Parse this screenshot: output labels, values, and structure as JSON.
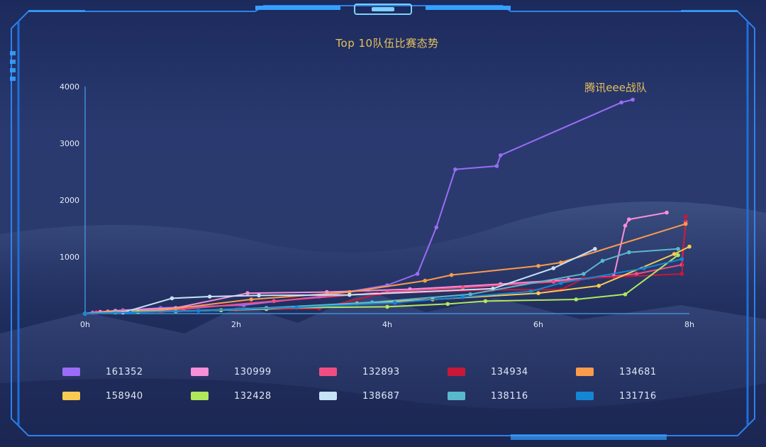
{
  "chart_data": {
    "type": "line",
    "title": "Top 10队伍比赛态势",
    "annotation": "腾讯eee战队",
    "xlim": [
      0,
      8
    ],
    "ylim": [
      0,
      4000
    ],
    "x_ticks": [
      {
        "v": 0,
        "label": "0h"
      },
      {
        "v": 2,
        "label": "2h"
      },
      {
        "v": 4,
        "label": "4h"
      },
      {
        "v": 6,
        "label": "6h"
      },
      {
        "v": 8,
        "label": "8h"
      }
    ],
    "y_ticks": [
      {
        "v": 1000,
        "label": "1000"
      },
      {
        "v": 2000,
        "label": "2000"
      },
      {
        "v": 3000,
        "label": "3000"
      },
      {
        "v": 4000,
        "label": "4000"
      }
    ],
    "grid": false,
    "legend_position": "bottom",
    "series": [
      {
        "name": "161352",
        "color": "#9a6cf7",
        "x": [
          0,
          0.1,
          0.3,
          0.5,
          1.0,
          2.1,
          3.1,
          4.0,
          4.4,
          4.65,
          4.9,
          5.45,
          5.5,
          7.1,
          7.25
        ],
        "y": [
          0,
          20,
          40,
          60,
          100,
          150,
          300,
          500,
          700,
          1520,
          2540,
          2600,
          2790,
          3720,
          3770
        ]
      },
      {
        "name": "130999",
        "color": "#f98fd8",
        "x": [
          0,
          0.2,
          0.4,
          1.2,
          2.15,
          3.2,
          4.3,
          5.5,
          6.4,
          7.0,
          7.15,
          7.2,
          7.7
        ],
        "y": [
          0,
          30,
          50,
          100,
          360,
          380,
          430,
          520,
          600,
          660,
          1550,
          1660,
          1780
        ]
      },
      {
        "name": "132893",
        "color": "#f24d83",
        "x": [
          0,
          0.15,
          0.5,
          1.3,
          2.5,
          4.0,
          5.0,
          6.2,
          7.3,
          7.9,
          7.95
        ],
        "y": [
          0,
          20,
          40,
          80,
          220,
          380,
          460,
          560,
          700,
          860,
          1620
        ]
      },
      {
        "name": "134934",
        "color": "#c9183a",
        "x": [
          0,
          0.3,
          1.0,
          2.0,
          3.1,
          3.9,
          5.4,
          6.3,
          6.6,
          7.9,
          7.95
        ],
        "y": [
          0,
          20,
          40,
          70,
          90,
          350,
          420,
          420,
          620,
          700,
          1710
        ]
      },
      {
        "name": "134681",
        "color": "#fb9b4c",
        "x": [
          0,
          0.3,
          1.0,
          2.2,
          3.5,
          4.5,
          4.85,
          6.0,
          6.3,
          7.95
        ],
        "y": [
          0,
          30,
          60,
          250,
          380,
          580,
          680,
          840,
          900,
          1580
        ]
      },
      {
        "name": "158940",
        "color": "#f8cc52",
        "x": [
          0,
          0.4,
          1.2,
          2.4,
          3.6,
          4.6,
          6.0,
          6.8,
          7.8,
          8.0
        ],
        "y": [
          0,
          20,
          40,
          80,
          180,
          250,
          360,
          490,
          1050,
          1180
        ]
      },
      {
        "name": "132428",
        "color": "#b0e85c",
        "x": [
          0,
          0.7,
          1.8,
          2.4,
          4.0,
          4.8,
          5.3,
          6.5,
          7.15,
          7.85
        ],
        "y": [
          0,
          30,
          60,
          100,
          120,
          170,
          220,
          250,
          340,
          1030
        ]
      },
      {
        "name": "138687",
        "color": "#c6e2f8",
        "x": [
          0,
          0.5,
          1.15,
          1.65,
          2.3,
          3.5,
          5.4,
          6.2,
          6.75
        ],
        "y": [
          0,
          20,
          270,
          300,
          320,
          330,
          440,
          800,
          1140
        ]
      },
      {
        "name": "138116",
        "color": "#5ab8cc",
        "x": [
          0,
          0.4,
          1.2,
          2.4,
          3.8,
          5.1,
          6.6,
          6.85,
          7.2,
          7.85
        ],
        "y": [
          0,
          20,
          40,
          100,
          200,
          340,
          700,
          930,
          1080,
          1140
        ]
      },
      {
        "name": "131716",
        "color": "#1586d3",
        "x": [
          0,
          0.6,
          1.5,
          2.8,
          4.1,
          5.0,
          5.9,
          6.3,
          7.4,
          7.9
        ],
        "y": [
          0,
          20,
          50,
          110,
          190,
          290,
          390,
          540,
          800,
          960
        ]
      }
    ]
  }
}
